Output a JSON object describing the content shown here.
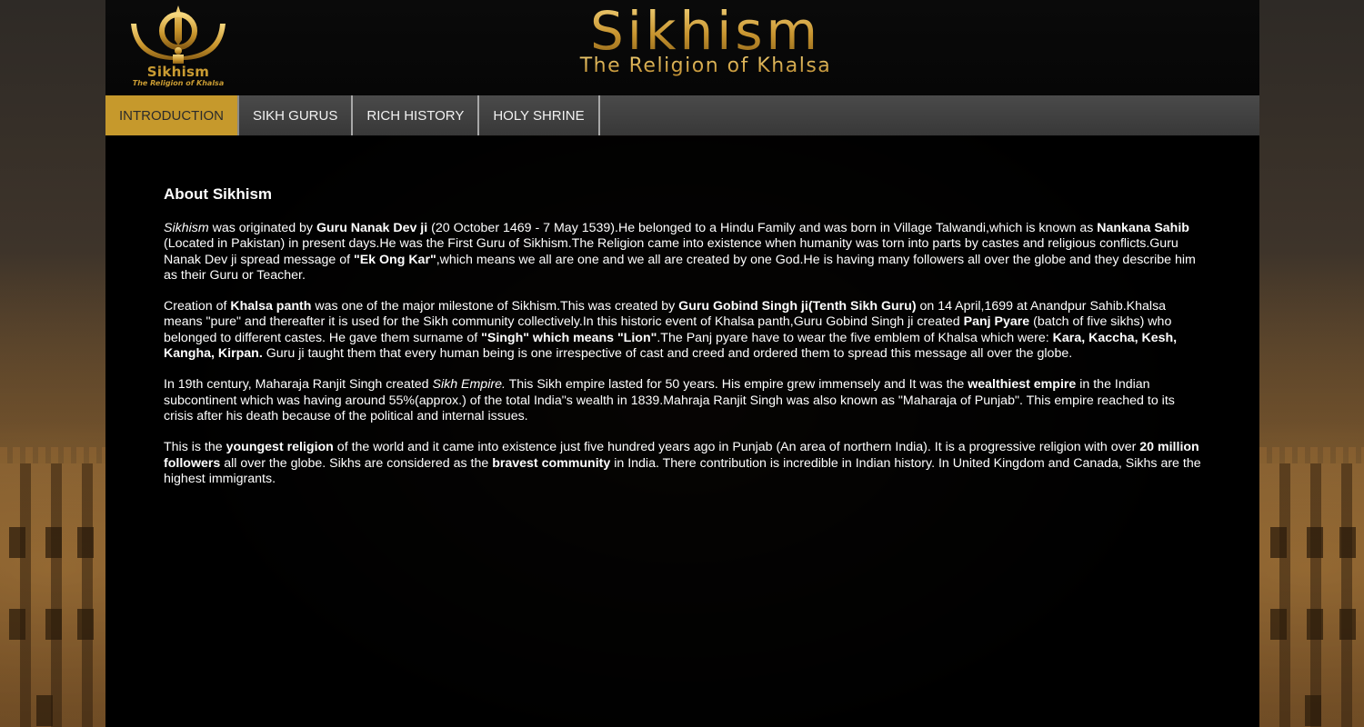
{
  "header": {
    "logo_text": "Sikhism",
    "logo_subtext": "The Religion of Khalsa",
    "banner_title": "Sikhism",
    "banner_subtitle": "The Religion of Khalsa"
  },
  "nav": {
    "items": [
      {
        "label": "INTRODUCTION",
        "active": true
      },
      {
        "label": "SIKH GURUS",
        "active": false
      },
      {
        "label": "RICH HISTORY",
        "active": false
      },
      {
        "label": "HOLY SHRINE",
        "active": false
      }
    ]
  },
  "colors": {
    "accent_gold": "#c6992c",
    "nav_bg": "#404040",
    "content_bg": "#000000",
    "text": "#ffffff"
  },
  "content": {
    "heading": "About Sikhism",
    "p1": {
      "s1": "Sikhism",
      "s2": " was originated by ",
      "s3": "Guru Nanak Dev ji",
      "s4": " (20 October 1469 - 7 May 1539).He belonged to a Hindu Family and was born in Village Talwandi,which is known as ",
      "s5": "Nankana Sahib",
      "s6": " (Located in Pakistan) in present days.He was the First Guru of Sikhism.The Religion came into existence when humanity was torn into parts by castes and religious conflicts.Guru Nanak Dev ji spread message of ",
      "s7": "\"Ek Ong Kar\"",
      "s8": ",which means we all are one and we all are created by one God.He is having many followers all over the globe and they describe him as their Guru or Teacher."
    },
    "p2": {
      "s1": "Creation of ",
      "s2": "Khalsa panth",
      "s3": " was one of the major milestone of Sikhism.This was created by ",
      "s4": "Guru Gobind Singh ji(Tenth Sikh Guru)",
      "s5": " on 14 April,1699 at Anandpur Sahib.Khalsa means \"pure\" and thereafter it is used for the Sikh community collectively.In this historic event of Khalsa panth,Guru Gobind Singh ji created ",
      "s6": "Panj Pyare",
      "s7": " (batch of five sikhs) who belonged to different castes. He gave them surname of ",
      "s8": "\"Singh\" which means \"Lion\"",
      "s9": ".The Panj pyare have to wear the five emblem of Khalsa which were: ",
      "s10": "Kara, Kaccha, Kesh, Kangha, Kirpan.",
      "s11": " Guru ji taught them that every human being is one irrespective of cast and creed and ordered them to spread this message all over the globe."
    },
    "p3": {
      "s1": "In 19th century, Maharaja Ranjit Singh created ",
      "s2": "Sikh Empire.",
      "s3": " This Sikh empire lasted for 50 years. His empire grew immensely and It was the ",
      "s4": "wealthiest empire",
      "s5": " in the Indian subcontinent which was having around 55%(approx.) of the total India\"s wealth in 1839.Mahraja Ranjit Singh was also known as \"Maharaja of Punjab\". This empire reached to its crisis after his death because of the political and internal issues."
    },
    "p4": {
      "s1": "This is the ",
      "s2": "youngest religion",
      "s3": " of the world and it came into existence just five hundred years ago in Punjab (An area of northern India). It is a progressive religion with over ",
      "s4": "20 million followers",
      "s5": " all over the globe. Sikhs are considered as the ",
      "s6": "bravest community",
      "s7": " in India. There contribution is incredible in Indian history. In United Kingdom and Canada, Sikhs are the highest immigrants."
    }
  }
}
